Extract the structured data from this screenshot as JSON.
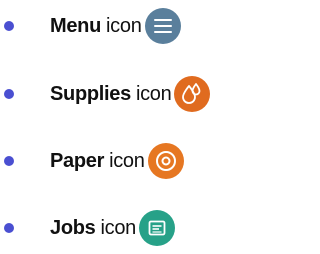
{
  "items": [
    {
      "name": "Menu",
      "suffix": "icon",
      "icon": "menu-icon",
      "color": "#5a7f9c"
    },
    {
      "name": "Supplies",
      "suffix": "icon",
      "icon": "supplies-icon",
      "color": "#e06b1f"
    },
    {
      "name": "Paper",
      "suffix": "icon",
      "icon": "paper-icon",
      "color": "#e67722"
    },
    {
      "name": "Jobs",
      "suffix": "icon",
      "icon": "jobs-icon",
      "color": "#27a188"
    }
  ],
  "colors": {
    "bullet": "#4a4fd1",
    "text": "#111111"
  }
}
